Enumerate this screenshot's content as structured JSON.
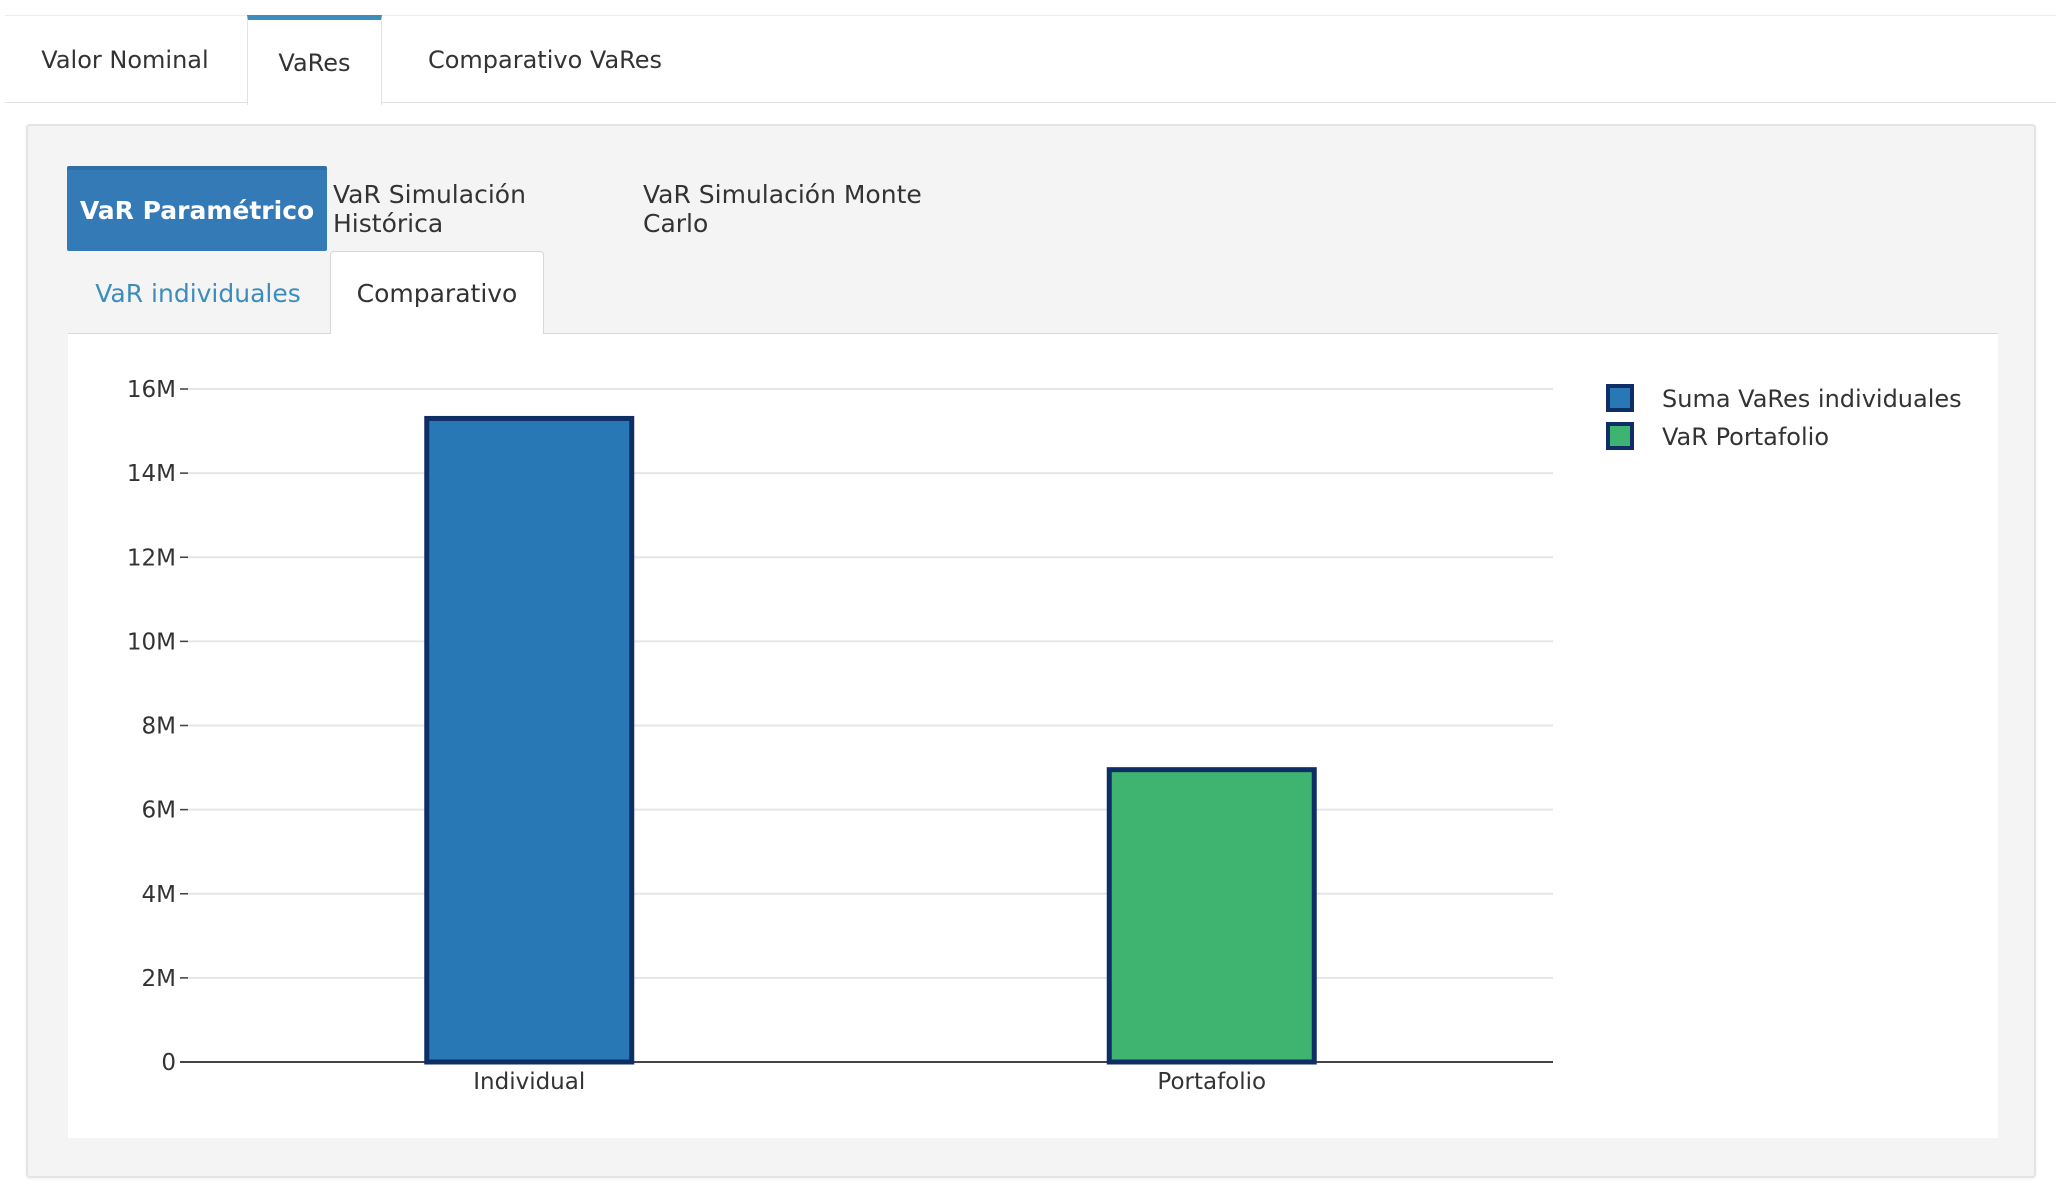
{
  "top_tabs": [
    {
      "label": "Valor Nominal"
    },
    {
      "label": "VaRes"
    },
    {
      "label": "Comparativo VaRes"
    }
  ],
  "method_tabs": [
    {
      "label": "VaR Paramétrico"
    },
    {
      "label": "VaR Simulación Histórica"
    },
    {
      "label": "VaR Simulación Monte Carlo"
    }
  ],
  "sub_tabs": [
    {
      "label": "VaR individuales"
    },
    {
      "label": "Comparativo"
    }
  ],
  "chart_data": {
    "type": "bar",
    "categories": [
      "Individual",
      "Portafolio"
    ],
    "series": [
      {
        "name": "Suma VaRes individuales",
        "category": "Individual",
        "value": 15300000,
        "color": "#2878b5"
      },
      {
        "name": "VaR Portafolio",
        "category": "Portafolio",
        "value": 6950000,
        "color": "#3fb370"
      }
    ],
    "bar_outline_color": "#0e2e66",
    "ylim": [
      0,
      16000000
    ],
    "yticks": [
      0,
      2000000,
      4000000,
      6000000,
      8000000,
      10000000,
      12000000,
      14000000,
      16000000
    ],
    "ytick_labels": [
      "0",
      "2M",
      "4M",
      "6M",
      "8M",
      "10M",
      "12M",
      "14M",
      "16M"
    ],
    "grid": true,
    "legend_position": "top-right",
    "title": "",
    "xlabel": "",
    "ylabel": ""
  }
}
